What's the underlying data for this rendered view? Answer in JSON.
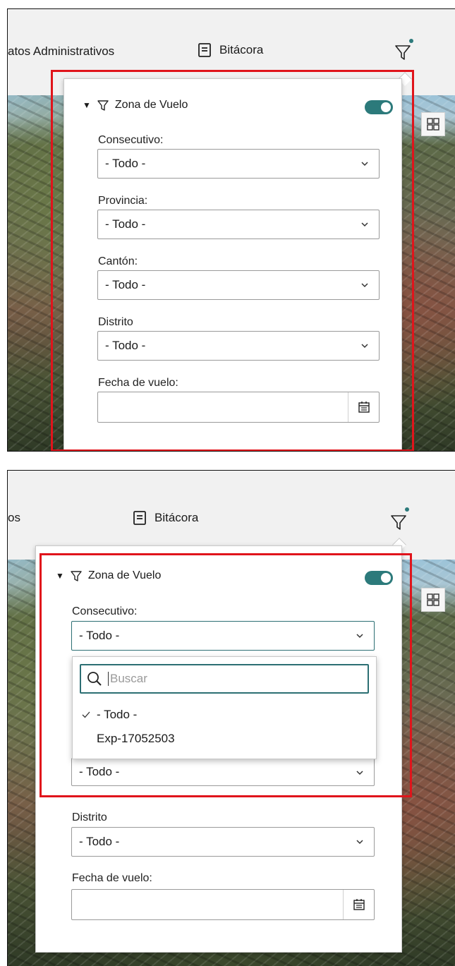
{
  "top": {
    "nav_partial": "atos Administrativos",
    "bitacora": "Bitácora"
  },
  "bottom": {
    "nav_partial": "os",
    "bitacora": "Bitácora"
  },
  "section": {
    "title": "Zona de Vuelo",
    "toggle_on": true
  },
  "fields": {
    "consecutivo_label": "Consecutivo:",
    "consecutivo_value": "- Todo -",
    "provincia_label": "Provincia:",
    "provincia_value": "- Todo -",
    "canton_label": "Cantón:",
    "canton_value": "- Todo -",
    "distrito_label": "Distrito",
    "distrito_value": "- Todo -",
    "fecha_label": "Fecha de vuelo:"
  },
  "dropdown": {
    "search_placeholder": "Buscar",
    "options": [
      "- Todo -",
      "Exp-17052503"
    ],
    "selected_index": 0,
    "partial_obscured": "- Todo -"
  },
  "colors": {
    "accent": "#2c7a7b",
    "highlight": "#e0141b"
  },
  "icons": {
    "filter": "filter-icon",
    "document": "document-icon",
    "calendar": "calendar-icon",
    "search": "search-icon",
    "chevron": "chevron-down-icon",
    "grid": "grid-icon"
  }
}
